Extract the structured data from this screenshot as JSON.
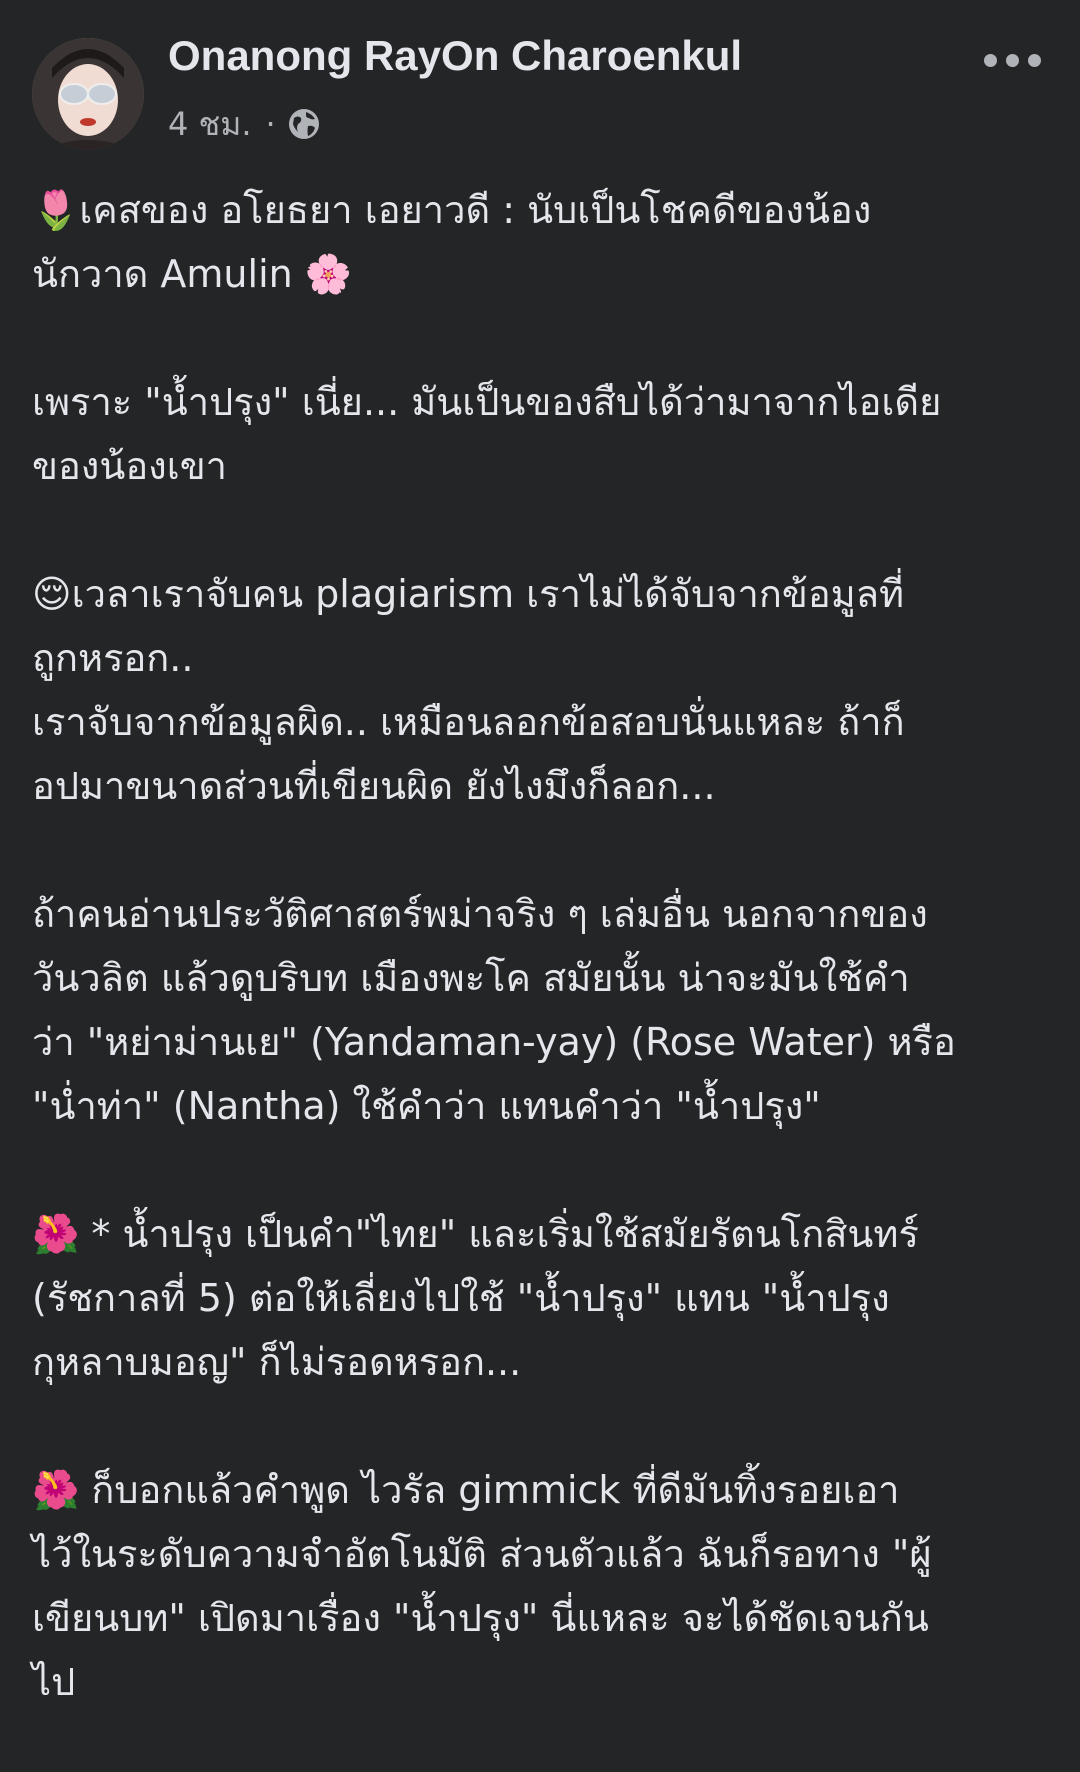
{
  "post": {
    "author": "Onanong RayOn Charoenkul",
    "time": "4 ชม.",
    "separator": "·",
    "privacy_icon": "globe-icon",
    "more_icon": "more-options-icon",
    "paragraphs": [
      {
        "lines": [
          "🌷เคสของ อโยธยา เอยาวดี :  นับเป็นโชคดีของน้อง",
          "นักวาด Amulin 🌸"
        ]
      },
      {
        "lines": [
          "เพราะ \"น้ำปรุง\" เนี่ย... มันเป็นของสืบได้ว่ามาจากไอเดีย",
          "ของน้องเขา"
        ]
      },
      {
        "lines": [
          "😌เวลาเราจับคน plagiarism เราไม่ได้จับจากข้อมูลที่",
          "ถูกหรอก..",
          "เราจับจากข้อมูลผิด.. เหมือนลอกข้อสอบนั่นแหละ ถ้าก็",
          "อปมาขนาดส่วนที่เขียนผิด ยังไงมึงก็ลอก..."
        ]
      },
      {
        "lines": [
          "ถ้าคนอ่านประวัติศาสตร์พม่าจริง ๆ เล่มอื่น นอกจากของ",
          "วันวลิต แล้วดูบริบท เมืองพะโค สมัยนั้น น่าจะมันใช้คำ",
          "ว่า \"หย่าม่านเย\" (Yandaman-yay) (Rose Water)  หรือ",
          "\"น่ำท่า\" (Nantha) ใช้คำว่า แทนคำว่า \"น้ำปรุง\""
        ]
      },
      {
        "lines": [
          "🌺 * น้ำปรุง เป็นคำ\"ไทย\" และเริ่มใช้สมัยรัตนโกสินทร์",
          "(รัชกาลที่ 5) ต่อให้เลี่ยงไปใช้ \"น้ำปรุง\" แทน \"น้ำปรุง",
          "กุหลาบมอญ\" ก็ไม่รอดหรอก..."
        ]
      },
      {
        "lines": [
          "🌺 ก็บอกแล้วคำพูด ไวรัล gimmick ที่ดีมันทิ้งรอยเอา",
          "ไว้ในระดับความจำอัตโนมัติ  ส่วนตัวแล้ว ฉันก็รอทาง \"ผู้",
          "เขียนบท\" เปิดมาเรื่อง \"น้ำปรุง\" นี่แหละ จะได้ชัดเจนกัน",
          "ไป"
        ]
      }
    ]
  },
  "colors": {
    "background": "#242526",
    "text_primary": "#e4e6eb",
    "text_secondary": "#b0b3b8"
  }
}
